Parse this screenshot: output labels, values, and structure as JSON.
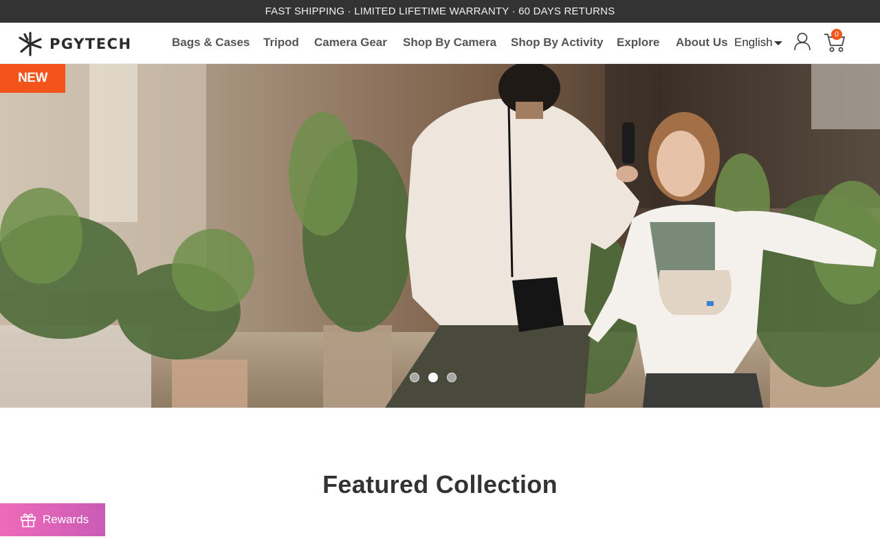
{
  "announcement": "FAST SHIPPING · LIMITED LIFETIME WARRANTY · 60 DAYS RETURNS",
  "brand": {
    "name": "PGYTECH"
  },
  "nav": {
    "items": [
      {
        "label": "Bags & Cases"
      },
      {
        "label": "Tripod"
      },
      {
        "label": "Camera Gear"
      },
      {
        "label": "Shop By Camera"
      },
      {
        "label": "Shop By Activity"
      },
      {
        "label": "Explore"
      },
      {
        "label": "About Us"
      }
    ],
    "language": "English"
  },
  "header_icons": {
    "account": "user-icon",
    "cart": "cart-icon",
    "cart_count": "0"
  },
  "hero": {
    "badge": "NEW",
    "slides": {
      "total": 3,
      "active_index": 1
    }
  },
  "featured": {
    "title": "Featured Collection"
  },
  "rewards": {
    "label": "Rewards",
    "icon": "gift-icon"
  },
  "colors": {
    "accent": "#f2541b",
    "announcement_bg": "#333333",
    "rewards_gradient_start": "#ee6ab9",
    "rewards_gradient_end": "#c95bb6"
  }
}
